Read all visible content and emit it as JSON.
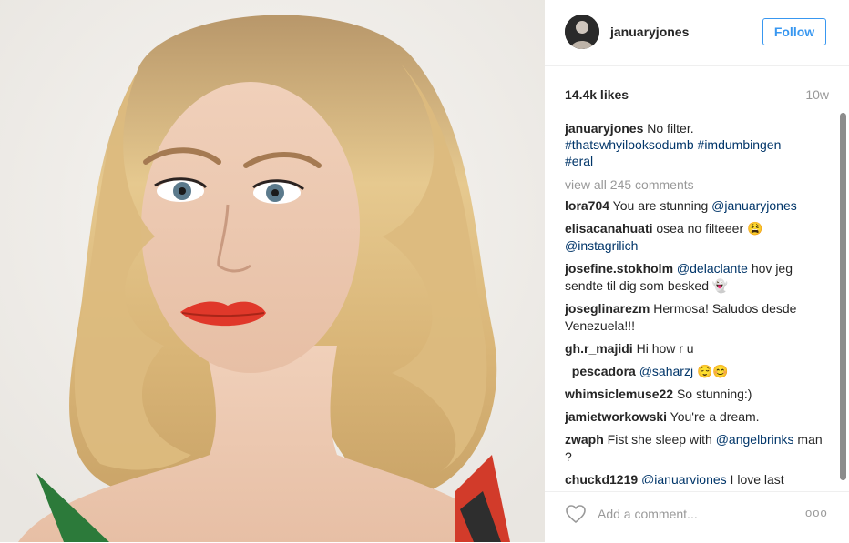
{
  "post": {
    "username": "januaryjones",
    "follow_label": "Follow",
    "likes": "14.4k likes",
    "time": "10w",
    "caption": {
      "user": "januaryjones",
      "text": " No filter.",
      "tags": [
        "#thatswhyilooksodumb",
        "#imdumbingen",
        "#eral"
      ]
    },
    "view_all": "view all 245 comments",
    "add_comment_placeholder": "Add a comment...",
    "more": "ooo"
  },
  "comments": [
    {
      "user": "lora704",
      "parts": [
        " You are stunning ",
        "@januaryjones"
      ]
    },
    {
      "user": "elisacanahuati",
      "parts": [
        " osea no filteeer 😩 ",
        "@instagrilich"
      ]
    },
    {
      "user": "josefine.stokholm",
      "parts": [
        " ",
        "@delaclante",
        " hov jeg sendte til dig som besked 👻"
      ]
    },
    {
      "user": "joseglinarezm",
      "parts": [
        " Hermosa! Saludos desde Venezuela!!!"
      ]
    },
    {
      "user": "gh.r_majidi",
      "parts": [
        " Hi how r u"
      ]
    },
    {
      "user": "_pescadora",
      "parts": [
        " ",
        "@saharzj",
        " 😌😊"
      ]
    },
    {
      "user": "whimsiclemuse22",
      "parts": [
        " So stunning:)"
      ]
    },
    {
      "user": "jamietworkowski",
      "parts": [
        " You're a dream."
      ]
    },
    {
      "user": "zwaph",
      "parts": [
        " Fist she sleep with ",
        "@angelbrinks",
        " man ?"
      ]
    },
    {
      "user": "chuckd1219",
      "parts": [
        " ",
        "@ianuarviones",
        " I love last"
      ]
    }
  ],
  "colors": {
    "accent": "#3897f0",
    "link": "#003569",
    "muted": "#999999"
  },
  "icons": {
    "heart": "heart-outline-icon",
    "more": "more-options-icon"
  }
}
